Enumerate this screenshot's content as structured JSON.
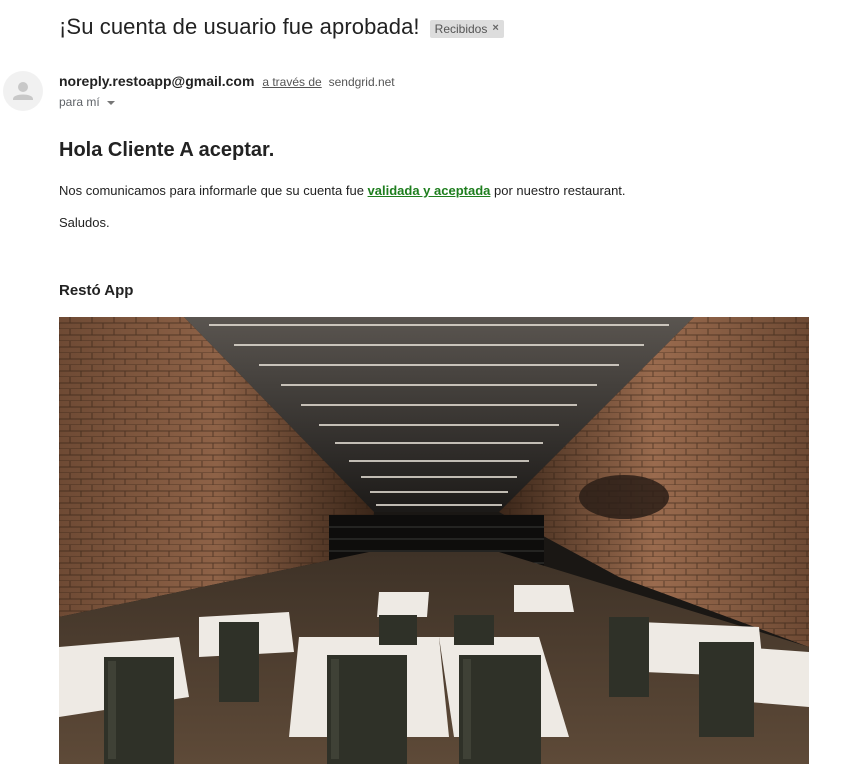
{
  "email": {
    "subject": "¡Su cuenta de usuario fue aprobada!",
    "label": "Recibidos",
    "sender": "noreply.restoapp@gmail.com",
    "via_text": "a través de",
    "via_domain": "sendgrid.net",
    "to": "para mí"
  },
  "message": {
    "greeting": "Hola Cliente A aceptar.",
    "paragraph_before": "Nos comunicamos para informarle que su cuenta fue ",
    "link_text": "validada y aceptada",
    "paragraph_after": " por nuestro restaurant.",
    "closing": "Saludos.",
    "signature": "Restó App"
  },
  "colors": {
    "link": "#1e7e1e",
    "label_bg": "#dddddd"
  },
  "icons": {
    "avatar": "person-icon",
    "label_remove": "close-icon",
    "recipient_details": "chevron-down-icon"
  }
}
